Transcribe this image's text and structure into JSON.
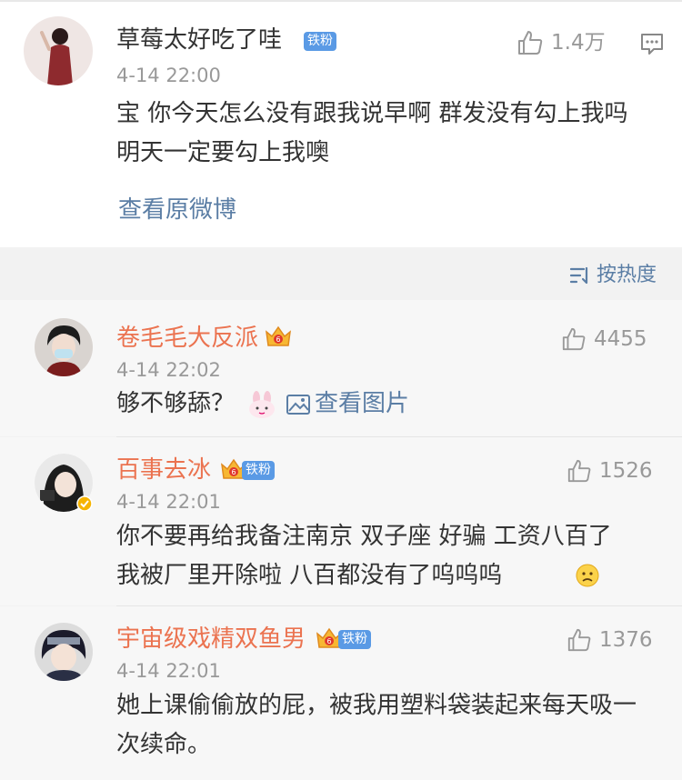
{
  "post": {
    "author": "草莓太好吃了哇",
    "badge": "铁粉",
    "time": "4-14 22:00",
    "likes": "1.4万",
    "text": "宝 你今天怎么没有跟我说早啊 群发没有勾上我吗 明天一定要勾上我噢",
    "view_original": "查看原微博"
  },
  "sort": {
    "label": "按热度"
  },
  "comments": [
    {
      "author": "卷毛毛大反派",
      "time": "4-14 22:02",
      "likes": "4455",
      "text": "够不够舔？",
      "view_image": "查看图片"
    },
    {
      "author": "百事去冰",
      "badge": "铁粉",
      "time": "4-14 22:01",
      "likes": "1526",
      "text": "你不要再给我备注南京 双子座 好骗 工资八百了 我被厂里开除啦 八百都没有了呜呜呜"
    },
    {
      "author": "宇宙级戏精双鱼男",
      "badge": "铁粉",
      "time": "4-14 22:01",
      "likes": "1376",
      "text": "她上课偷偷放的屁，被我用塑料袋装起来每天吸一次续命。"
    }
  ],
  "colors": {
    "link": "#5b7ea5",
    "username_vip": "#eb7350",
    "badge": "#5a9ae5",
    "meta": "#999999"
  }
}
